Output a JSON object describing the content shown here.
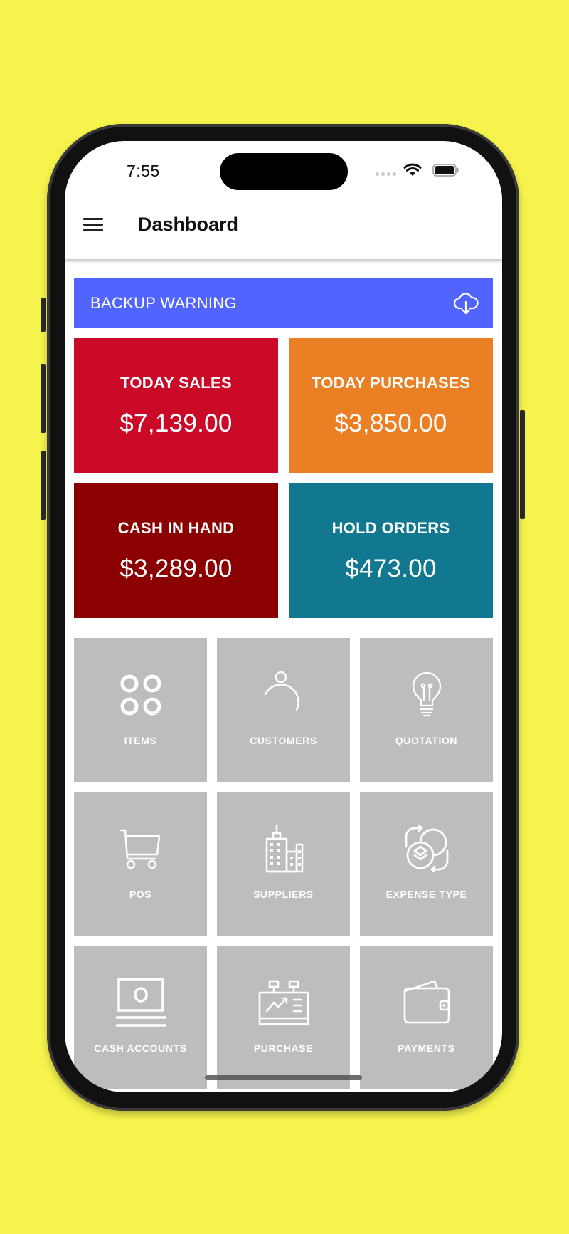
{
  "status_bar": {
    "time": "7:55",
    "icons": [
      "signal-dots-icon",
      "wifi-icon",
      "battery-icon"
    ]
  },
  "app_bar": {
    "menu_icon": "hamburger-menu-icon",
    "title": "Dashboard"
  },
  "backup_banner": {
    "label": "BACKUP WARNING",
    "icon": "cloud-download-icon",
    "color": "#5264fe"
  },
  "stats": [
    {
      "label": "TODAY SALES",
      "value": "$7,139.00",
      "color": "#cb0a27"
    },
    {
      "label": "TODAY PURCHASES",
      "value": "$3,850.00",
      "color": "#eb7f23"
    },
    {
      "label": "CASH IN HAND",
      "value": "$3,289.00",
      "color": "#8b0000"
    },
    {
      "label": "HOLD ORDERS",
      "value": "$473.00",
      "color": "#11788f"
    }
  ],
  "tiles": [
    {
      "label": "ITEMS",
      "icon": "four-circles-icon"
    },
    {
      "label": "CUSTOMERS",
      "icon": "person-icon"
    },
    {
      "label": "QUOTATION",
      "icon": "lightbulb-icon"
    },
    {
      "label": "POS",
      "icon": "shopping-cart-icon"
    },
    {
      "label": "SUPPLIERS",
      "icon": "buildings-icon"
    },
    {
      "label": "EXPENSE TYPE",
      "icon": "coin-exchange-icon"
    },
    {
      "label": "CASH ACCOUNTS",
      "icon": "cash-register-icon"
    },
    {
      "label": "PURCHASE",
      "icon": "sales-board-icon"
    },
    {
      "label": "PAYMENTS",
      "icon": "wallet-icon"
    }
  ],
  "colors": {
    "background": "#f6f44c",
    "tile_bg": "#bdbdbd"
  }
}
